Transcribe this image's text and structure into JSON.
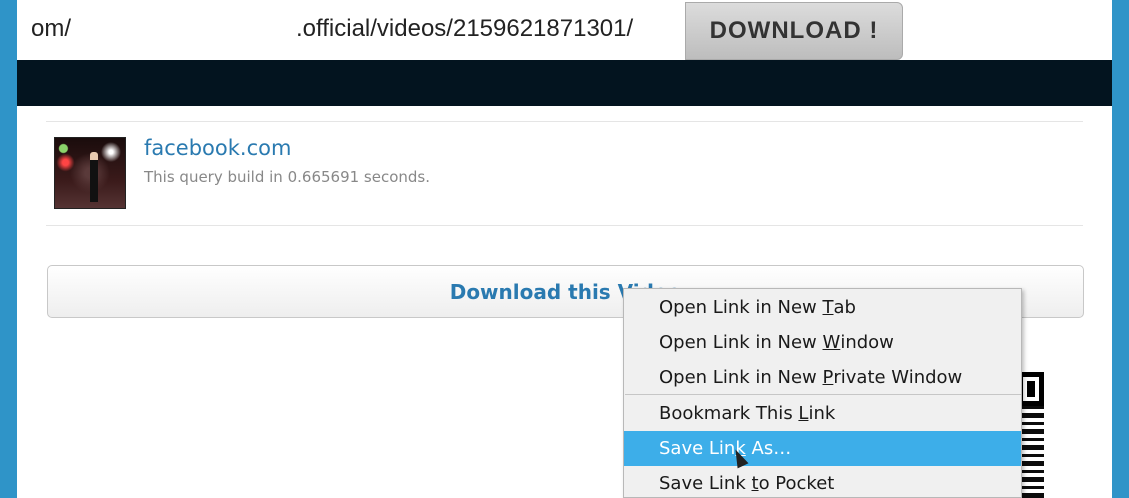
{
  "url_bar": {
    "text_left": "om/",
    "text_right": ".official/videos/2159621871301/"
  },
  "download_button": {
    "label": "DOWNLOAD !"
  },
  "result": {
    "site": "facebook.com",
    "query_time": "This query build in 0.665691 seconds."
  },
  "download_video_button": {
    "label": "Download this Video"
  },
  "context_menu": {
    "items": [
      {
        "pre": "Open Link in New ",
        "ul": "T",
        "post": "ab"
      },
      {
        "pre": "Open Link in New ",
        "ul": "W",
        "post": "indow"
      },
      {
        "pre": "Open Link in New ",
        "ul": "P",
        "post": "rivate Window"
      },
      {
        "pre": "Bookmark This ",
        "ul": "L",
        "post": "ink"
      },
      {
        "pre": "Save Lin",
        "ul": "k",
        "post": " As…"
      },
      {
        "pre": "Save Link ",
        "ul": "t",
        "post": "o Pocket"
      }
    ]
  },
  "colors": {
    "accent": "#2f94c8",
    "dark_bar": "#03141f",
    "link": "#2a7ab0",
    "menu_highlight": "#3daee9"
  }
}
